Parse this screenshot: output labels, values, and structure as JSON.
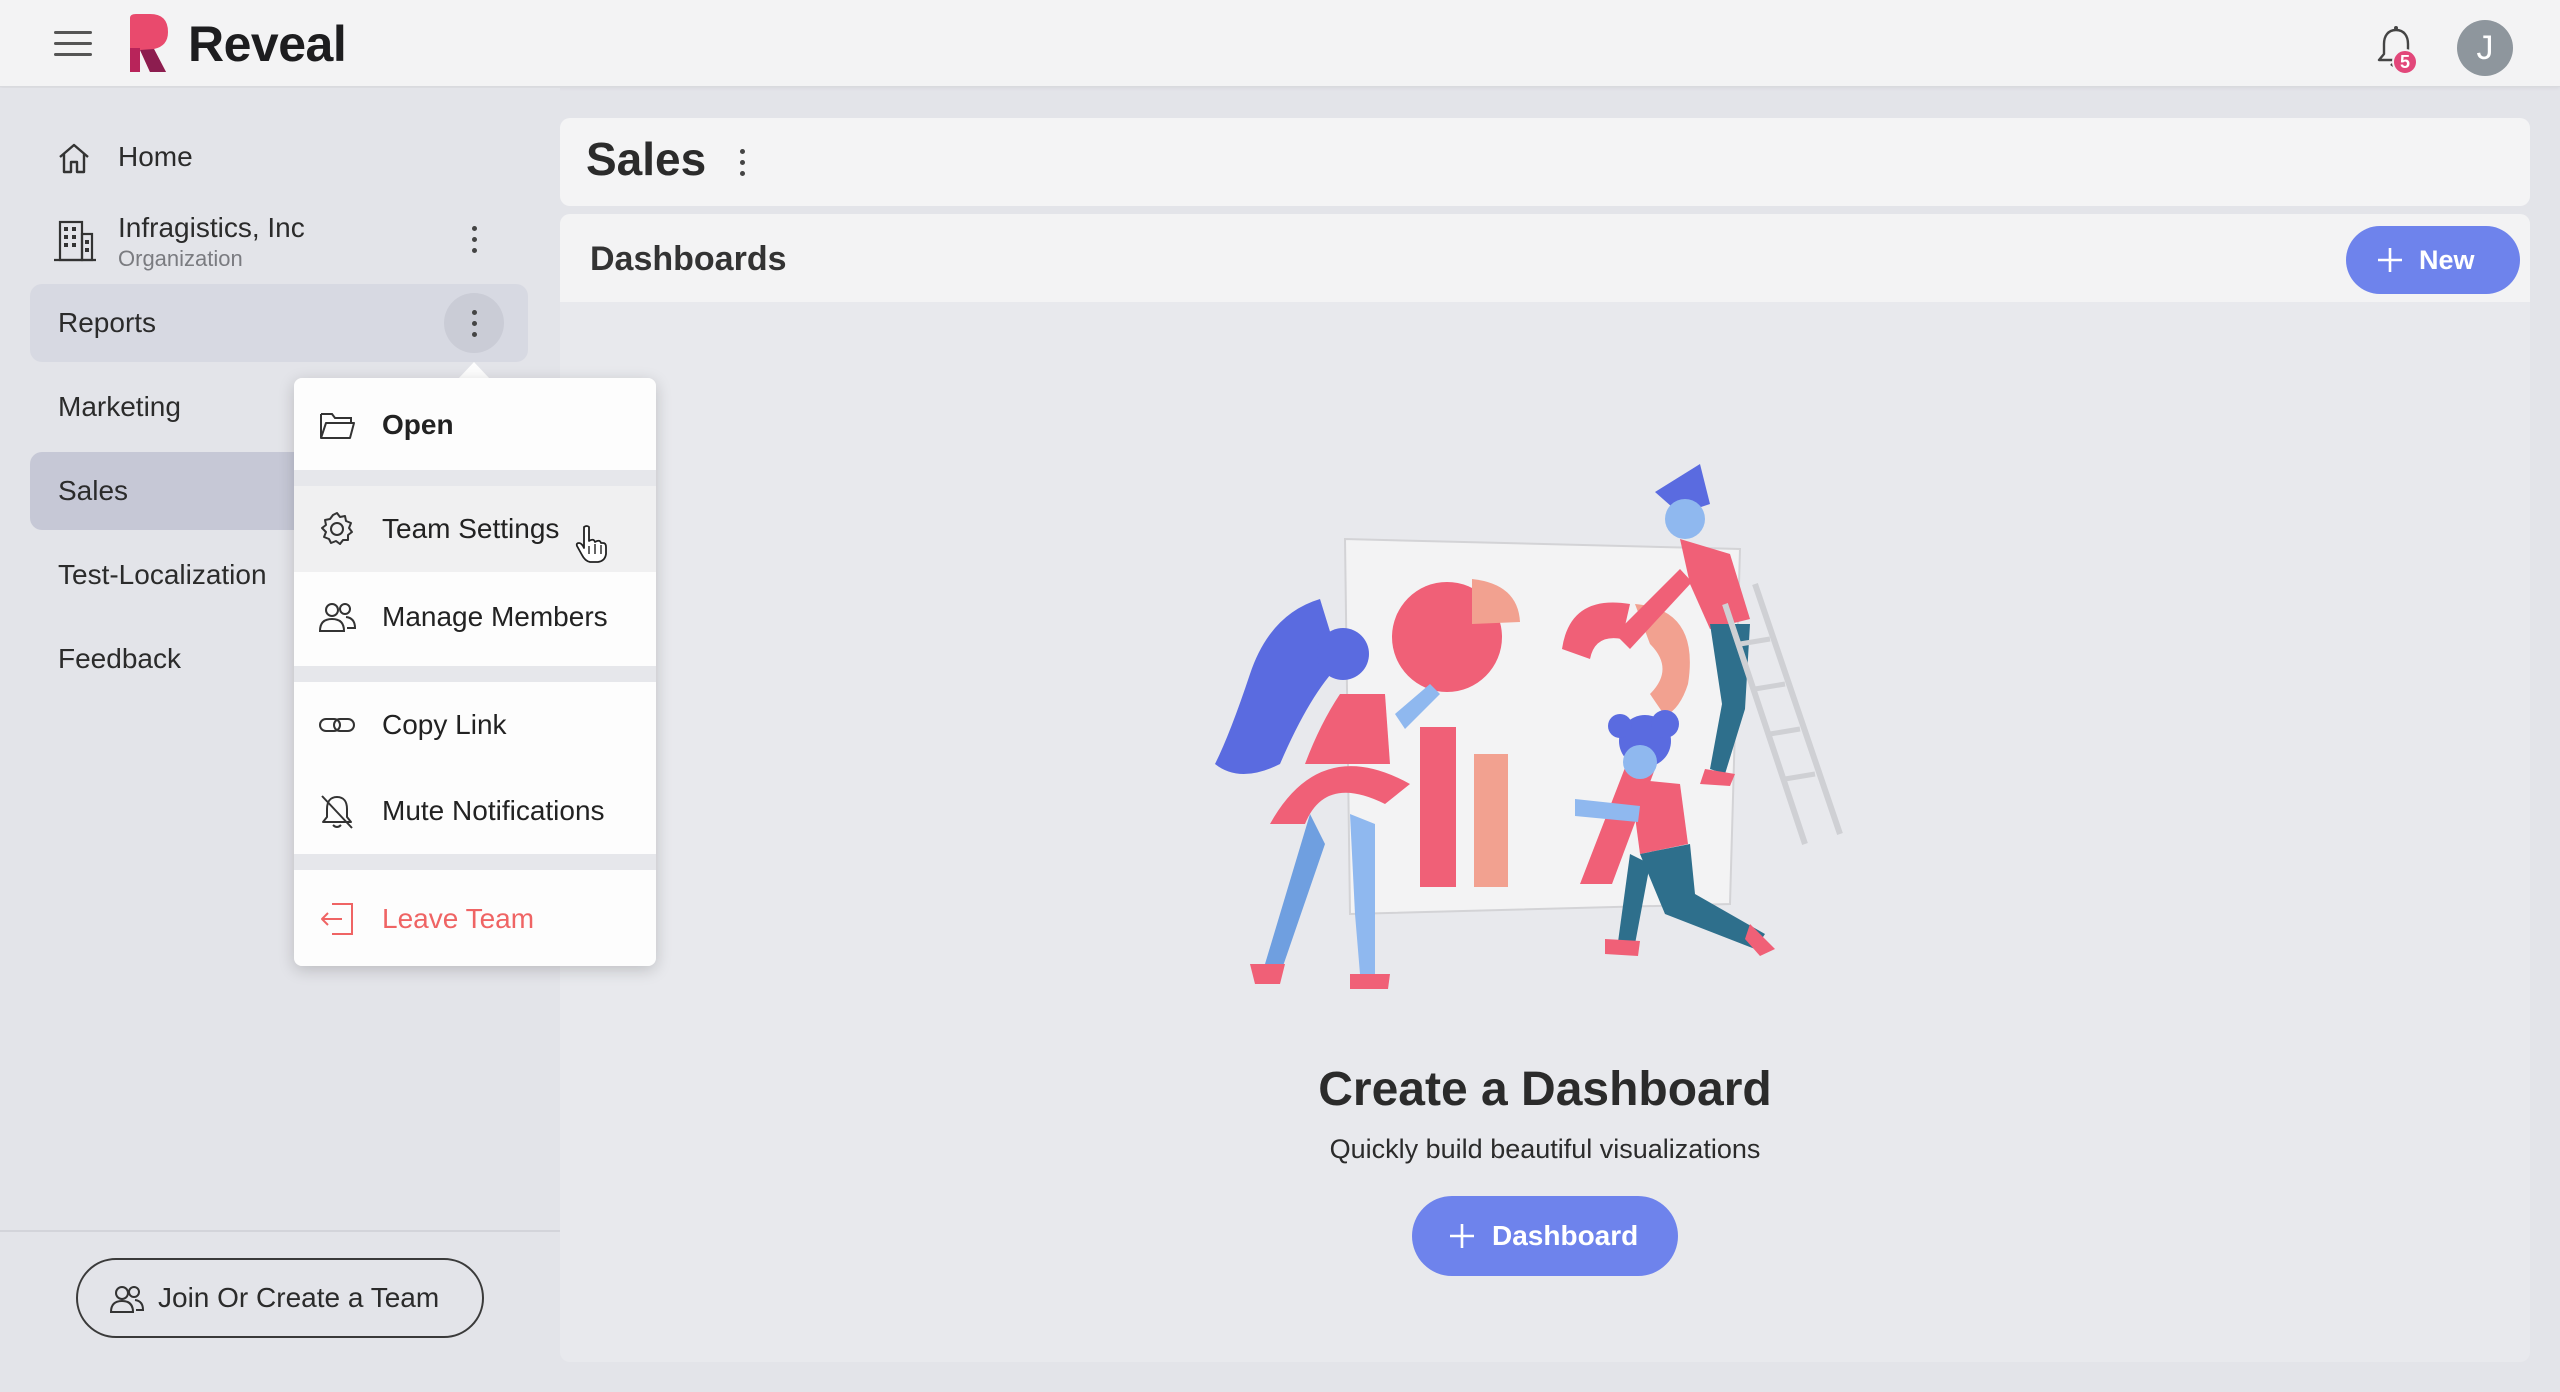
{
  "app": {
    "name": "Reveal",
    "notification_count": "5",
    "user_initial": "J"
  },
  "sidebar": {
    "home_label": "Home",
    "org": {
      "name": "Infragistics, Inc",
      "subtitle": "Organization"
    },
    "teams": [
      {
        "label": "Reports"
      },
      {
        "label": "Marketing"
      },
      {
        "label": "Sales"
      },
      {
        "label": "Test-Localization"
      },
      {
        "label": "Feedback"
      }
    ],
    "join_label": "Join Or Create a Team"
  },
  "main": {
    "page_title": "Sales",
    "section_title": "Dashboards",
    "new_label": "New",
    "empty_title": "Create a Dashboard",
    "empty_subtitle": "Quickly build beautiful visualizations",
    "dashboard_button": "Dashboard"
  },
  "context_menu": {
    "items": [
      {
        "label": "Open",
        "icon": "folder-open-icon"
      },
      {
        "label": "Team Settings",
        "icon": "gear-icon"
      },
      {
        "label": "Manage Members",
        "icon": "people-icon"
      },
      {
        "label": "Copy Link",
        "icon": "link-icon"
      },
      {
        "label": "Mute Notifications",
        "icon": "bell-off-icon"
      },
      {
        "label": "Leave Team",
        "icon": "exit-icon"
      }
    ]
  },
  "colors": {
    "accent": "#6e83ec",
    "selected_team": "#c6c8d6",
    "danger": "#ef6464",
    "badge": "#e2477a"
  }
}
